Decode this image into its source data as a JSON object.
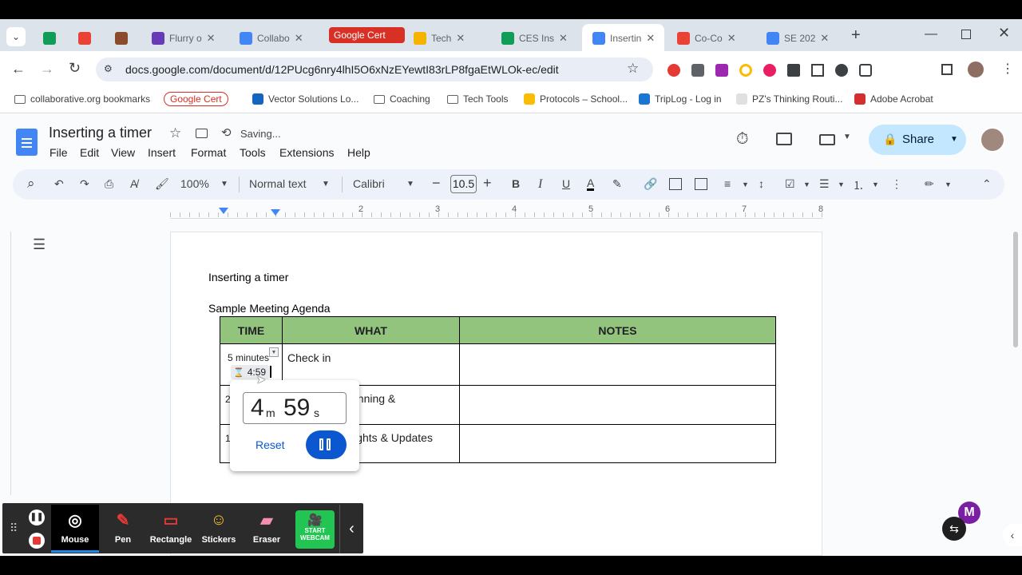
{
  "browser": {
    "tabs": [
      {
        "label": "",
        "icon": "google-sheets-icon",
        "color": "#0f9d58"
      },
      {
        "label": "",
        "icon": "gmail-icon",
        "color": "#ea4335"
      },
      {
        "label": "",
        "icon": "settings-app-icon",
        "color": "#8b4a2b"
      },
      {
        "label": "Flurry o",
        "icon": "google-forms-icon",
        "color": "#673ab7"
      },
      {
        "label": "Collabo",
        "icon": "google-calendar-icon",
        "color": "#4285f4"
      },
      {
        "label": "Google Cert",
        "icon": "google-cert-icon",
        "color": "#d93025"
      },
      {
        "label": "Tech",
        "icon": "google-slides-icon",
        "color": "#f4b400"
      },
      {
        "label": "CES Ins",
        "icon": "google-sheets-icon",
        "color": "#0f9d58"
      },
      {
        "label": "Insertin",
        "icon": "google-docs-icon",
        "color": "#4285f4"
      },
      {
        "label": "Co-Co",
        "icon": "gmail-icon",
        "color": "#ea4335"
      },
      {
        "label": "SE 202",
        "icon": "google-docs-icon",
        "color": "#4285f4"
      }
    ],
    "url": "docs.google.com/document/d/12PUcg6nry4lhI5O6xNzEYewtI83rLP8fgaEtWLOk-ec/edit",
    "bookmarks": [
      {
        "label": "collaborative.org bookmarks",
        "icon": "folder-icon"
      },
      {
        "label": "Google Cert",
        "icon": "google-cert-chip"
      },
      {
        "label": "Vector Solutions Lo...",
        "icon": "vector-icon"
      },
      {
        "label": "Coaching",
        "icon": "folder-icon"
      },
      {
        "label": "Tech Tools",
        "icon": "folder-icon"
      },
      {
        "label": "Protocols – School...",
        "icon": "protocols-icon"
      },
      {
        "label": "TripLog - Log in",
        "icon": "triplog-icon"
      },
      {
        "label": "PZ's Thinking Routi...",
        "icon": "pz-icon"
      },
      {
        "label": "Adobe Acrobat",
        "icon": "acrobat-icon"
      }
    ]
  },
  "docs": {
    "title": "Inserting a timer",
    "save_status": "Saving...",
    "menus": [
      "File",
      "Edit",
      "View",
      "Insert",
      "Format",
      "Tools",
      "Extensions",
      "Help"
    ],
    "share_label": "Share",
    "zoom": "100%",
    "style": "Normal text",
    "font": "Calibri",
    "font_size": "10.5",
    "ruler_numbers": [
      "2",
      "3",
      "4",
      "5",
      "6",
      "7",
      "8"
    ]
  },
  "document": {
    "heading": "Inserting a timer",
    "subheading": "Sample Meeting Agenda",
    "table": {
      "headers": [
        "TIME",
        "WHAT",
        "NOTES"
      ],
      "rows": [
        {
          "time": "5 minutes",
          "what": "Check in",
          "notes": ""
        },
        {
          "time": "2",
          "what": "anning &",
          "notes": ""
        },
        {
          "time": "1",
          "what": "lights & Updates",
          "notes": ""
        }
      ],
      "header_color": "#93c47d"
    },
    "timer_chip": "4:59"
  },
  "timer_popup": {
    "minutes": "4",
    "minutes_unit": "m",
    "seconds": "59",
    "seconds_unit": "s",
    "reset_label": "Reset",
    "action": "pause"
  },
  "annotation_toolbar": {
    "tools": [
      {
        "label": "Mouse",
        "icon": "mouse-icon"
      },
      {
        "label": "Pen",
        "icon": "pen-icon"
      },
      {
        "label": "Rectangle",
        "icon": "rectangle-icon"
      },
      {
        "label": "Stickers",
        "icon": "sticker-icon"
      },
      {
        "label": "Eraser",
        "icon": "eraser-icon"
      }
    ],
    "webcam_line1": "START",
    "webcam_line2": "WEBCAM",
    "active_tool": "Mouse"
  }
}
